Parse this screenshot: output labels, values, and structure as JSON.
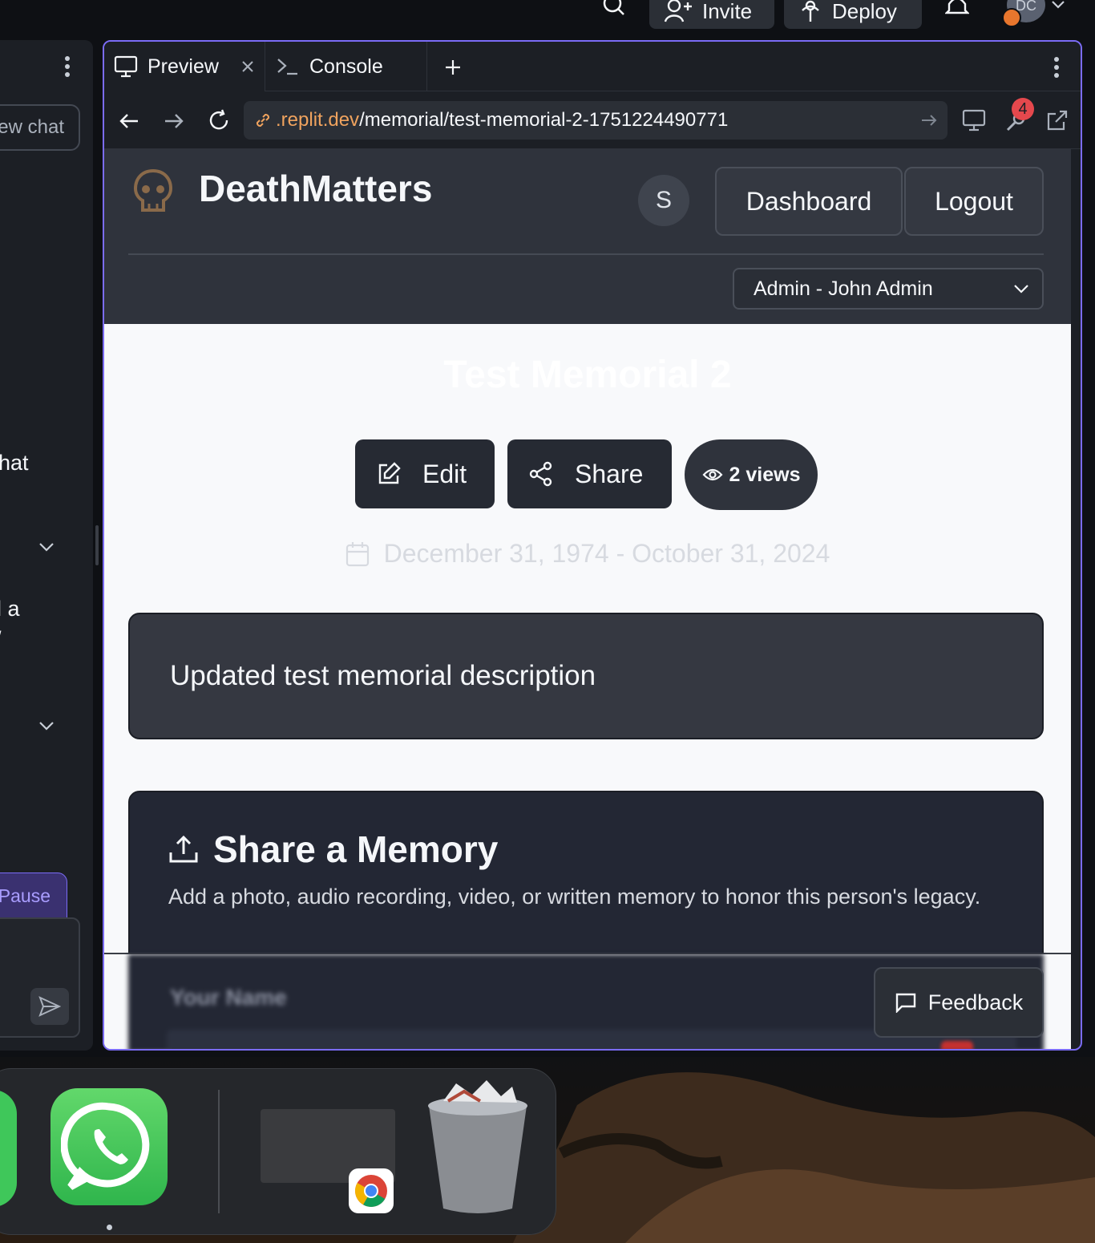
{
  "topbar": {
    "invite_label": "Invite",
    "deploy_label": "Deploy",
    "avatar_initials": "DC"
  },
  "left_panel": {
    "new_chat_label": "ew chat",
    "fragment_1": "hat",
    "fragment_2": "l a",
    "fragment_3": "/",
    "pause_label": "Pause"
  },
  "tabs": {
    "preview_label": "Preview",
    "console_label": "Console"
  },
  "url": {
    "domain_part": ".replit.dev",
    "path_part": "/memorial/test-memorial-2-1751224490771",
    "badge_count": "4"
  },
  "app": {
    "brand": "DeathMatters",
    "user_initial": "S",
    "dashboard_label": "Dashboard",
    "logout_label": "Logout",
    "role_select_value": "Admin - John Admin",
    "memorial_title": "Test Memorial 2",
    "edit_label": "Edit",
    "share_label": "Share",
    "views_label": "2 views",
    "dates": "December 31, 1974 - October 31, 2024",
    "description": "Updated test memorial description",
    "share_memory_title": "Share a Memory",
    "share_memory_subtitle": "Add a photo, audio recording, video, or written memory to honor this person's legacy.",
    "your_name_label": "Your Name",
    "feedback_label": "Feedback"
  },
  "colors": {
    "accent": "#7b6cf6",
    "brand_icon": "#8a6a4a",
    "link": "#f0a35e",
    "badge": "#e5484d"
  }
}
